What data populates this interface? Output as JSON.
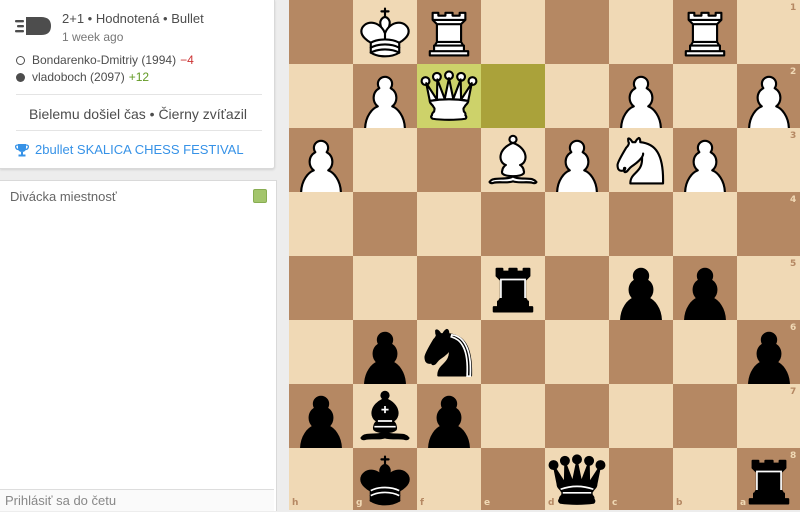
{
  "game": {
    "type": "2+1 • Hodnotená • Bullet",
    "time_ago": "1 week ago",
    "white_player": {
      "name": "Bondarenko-Dmitriy (1994)",
      "diff": "−4"
    },
    "black_player": {
      "name": "vladoboch (2097)",
      "diff": "+12"
    },
    "result": "Bielemu došiel čas • Čierny zvíťazil",
    "tournament": "2bullet SKALICA CHESS FESTIVAL"
  },
  "chat": {
    "title": "Divácka miestnosť",
    "placeholder": "Prihlásiť sa do četu"
  },
  "board": {
    "orientation": "black",
    "files": [
      "h",
      "g",
      "f",
      "e",
      "d",
      "c",
      "b",
      "a"
    ],
    "ranks": [
      "1",
      "2",
      "3",
      "4",
      "5",
      "6",
      "7",
      "8"
    ],
    "highlighted_squares": [
      "f2",
      "e2"
    ],
    "pieces": [
      {
        "sq": "g1",
        "color": "w",
        "type": "k"
      },
      {
        "sq": "f1",
        "color": "w",
        "type": "r"
      },
      {
        "sq": "b1",
        "color": "w",
        "type": "r"
      },
      {
        "sq": "g2",
        "color": "w",
        "type": "p"
      },
      {
        "sq": "f2",
        "color": "w",
        "type": "q"
      },
      {
        "sq": "c2",
        "color": "w",
        "type": "p"
      },
      {
        "sq": "a2",
        "color": "w",
        "type": "p"
      },
      {
        "sq": "h3",
        "color": "w",
        "type": "p"
      },
      {
        "sq": "e3",
        "color": "w",
        "type": "b"
      },
      {
        "sq": "d3",
        "color": "w",
        "type": "p"
      },
      {
        "sq": "c3",
        "color": "w",
        "type": "n"
      },
      {
        "sq": "b3",
        "color": "w",
        "type": "p"
      },
      {
        "sq": "e5",
        "color": "b",
        "type": "r"
      },
      {
        "sq": "c5",
        "color": "b",
        "type": "p"
      },
      {
        "sq": "b5",
        "color": "b",
        "type": "p"
      },
      {
        "sq": "g6",
        "color": "b",
        "type": "p"
      },
      {
        "sq": "f6",
        "color": "b",
        "type": "n"
      },
      {
        "sq": "a6",
        "color": "b",
        "type": "p"
      },
      {
        "sq": "h7",
        "color": "b",
        "type": "p"
      },
      {
        "sq": "g7",
        "color": "b",
        "type": "b"
      },
      {
        "sq": "f7",
        "color": "b",
        "type": "p"
      },
      {
        "sq": "g8",
        "color": "b",
        "type": "k"
      },
      {
        "sq": "d8",
        "color": "b",
        "type": "q"
      },
      {
        "sq": "a8",
        "color": "b",
        "type": "r"
      }
    ]
  },
  "colors": {
    "light_square": "#f0d9b5",
    "dark_square": "#b58863",
    "highlight_light": "#cdd26a",
    "highlight_dark": "#aaa23a",
    "link": "#3692e7",
    "rating_loss": "#cc3333",
    "rating_gain": "#629924"
  },
  "icons": {
    "speed": "bullet-icon",
    "tournament": "trophy-icon",
    "chat_toggle": "toggle-icon"
  }
}
